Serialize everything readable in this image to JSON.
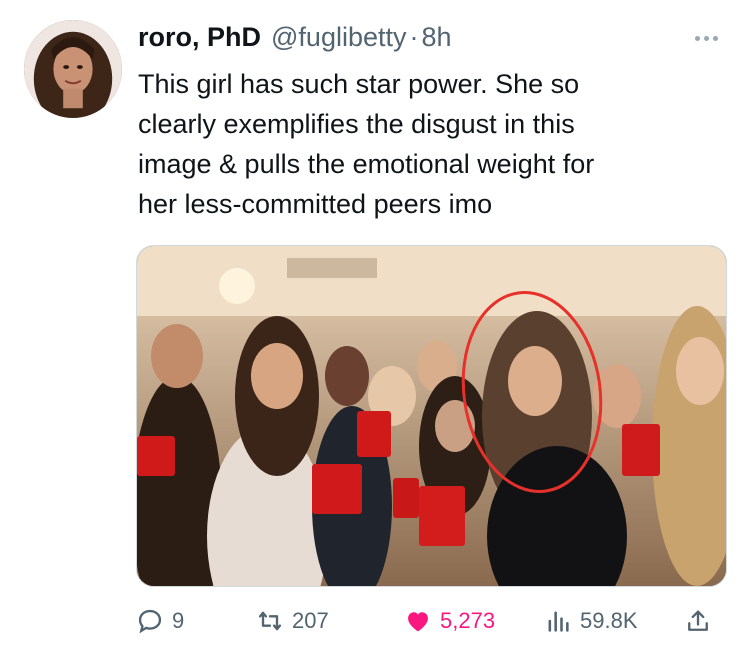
{
  "author": {
    "display_name": "roro, PhD",
    "handle": "@fuglibetty",
    "separator": "·",
    "time_ago": "8h"
  },
  "tweet": {
    "lines": [
      "This girl has such star power. She so",
      "clearly exemplifies the disgust in this",
      "image & pulls the emotional weight for",
      "her less-committed peers imo"
    ]
  },
  "actions": {
    "replies": "9",
    "retweets": "207",
    "likes": "5,273",
    "views": "59.8K"
  },
  "colors": {
    "like_active": "#f91880",
    "muted": "#536471",
    "annotation_circle": "#e8302a"
  },
  "icons": [
    "more-options-icon",
    "reply-icon",
    "retweet-icon",
    "heart-icon",
    "views-icon",
    "share-icon"
  ]
}
